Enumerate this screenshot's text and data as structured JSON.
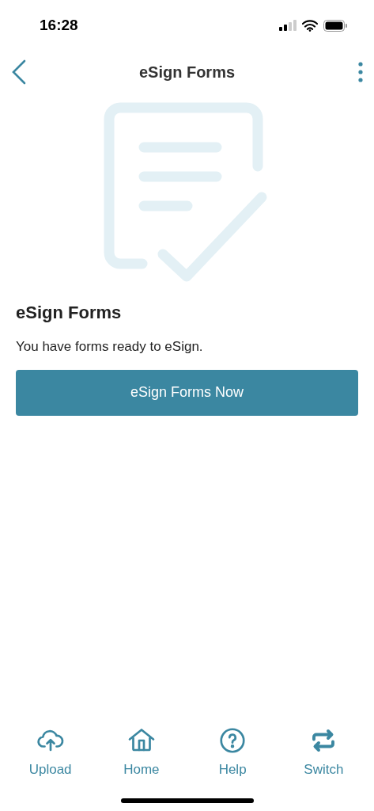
{
  "status_bar": {
    "time": "16:28"
  },
  "header": {
    "title": "eSign Forms"
  },
  "content": {
    "heading": "eSign Forms",
    "message": "You have forms ready to eSign.",
    "button": "eSign Forms Now"
  },
  "tab_bar": [
    {
      "kind": "upload",
      "label": "Upload"
    },
    {
      "kind": "home",
      "label": "Home"
    },
    {
      "kind": "help",
      "label": "Help"
    },
    {
      "kind": "switch",
      "label": "Switch"
    }
  ]
}
